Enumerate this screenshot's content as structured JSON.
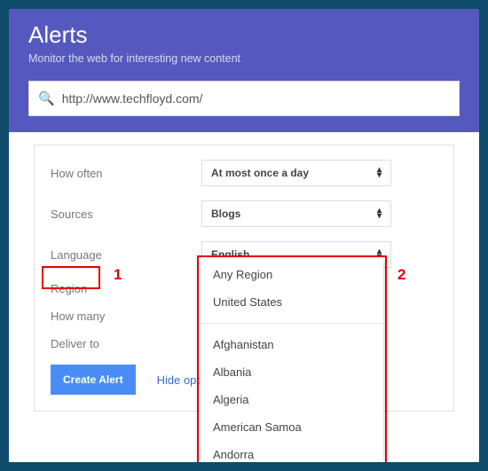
{
  "header": {
    "title": "Alerts",
    "subtitle": "Monitor the web for interesting new content"
  },
  "search": {
    "value": "http://www.techfloyd.com/"
  },
  "options": {
    "howOften": {
      "label": "How often",
      "value": "At most once a day"
    },
    "sources": {
      "label": "Sources",
      "value": "Blogs"
    },
    "language": {
      "label": "Language",
      "value": "English"
    },
    "region": {
      "label": "Region",
      "value": ""
    },
    "howMany": {
      "label": "How many",
      "value": ""
    },
    "deliverTo": {
      "label": "Deliver to",
      "value": ""
    }
  },
  "buttons": {
    "create": "Create Alert",
    "hide": "Hide options"
  },
  "dropdown": {
    "top": [
      "Any Region",
      "United States"
    ],
    "more": [
      "Afghanistan",
      "Albania",
      "Algeria",
      "American Samoa",
      "Andorra"
    ]
  },
  "annotations": {
    "n1": "1",
    "n2": "2"
  }
}
